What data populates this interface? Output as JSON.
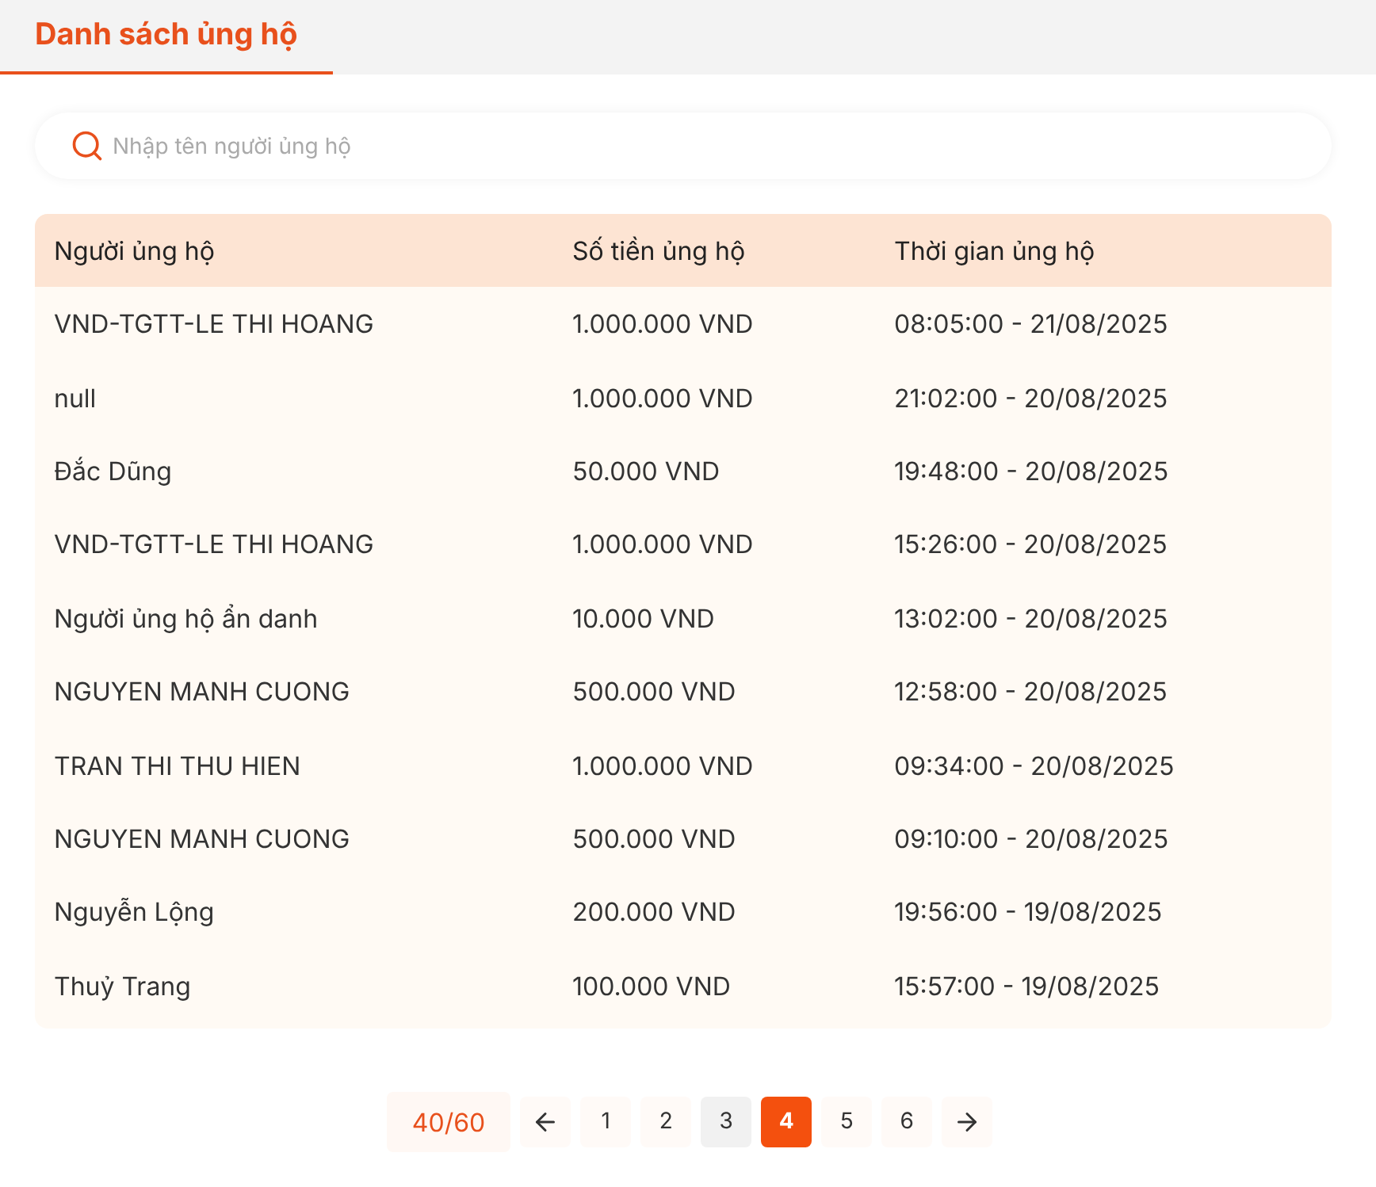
{
  "tabs": [
    {
      "label": "Danh sách ủng hộ",
      "selected": true
    }
  ],
  "search": {
    "placeholder": "Nhập tên người ủng hộ"
  },
  "table": {
    "columns": [
      "Người ủng hộ",
      "Số tiền ủng hộ",
      "Thời gian ủng hộ"
    ],
    "rows": [
      [
        "VND-TGTT-LE THI HOANG",
        "1.000.000 VND",
        "08:05:00 - 21/08/2025"
      ],
      [
        "null",
        "1.000.000 VND",
        "21:02:00 - 20/08/2025"
      ],
      [
        "Đắc Dũng",
        "50.000 VND",
        "19:48:00 - 20/08/2025"
      ],
      [
        "VND-TGTT-LE THI HOANG",
        "1.000.000 VND",
        "15:26:00 - 20/08/2025"
      ],
      [
        "Người ủng hộ ẩn danh",
        "10.000 VND",
        "13:02:00 - 20/08/2025"
      ],
      [
        "NGUYEN MANH CUONG",
        "500.000 VND",
        "12:58:00 - 20/08/2025"
      ],
      [
        "TRAN THI THU HIEN",
        "1.000.000 VND",
        "09:34:00 - 20/08/2025"
      ],
      [
        "NGUYEN MANH CUONG",
        "500.000 VND",
        "09:10:00 - 20/08/2025"
      ],
      [
        "Nguyễn Lộng",
        "200.000 VND",
        "19:56:00 - 19/08/2025"
      ],
      [
        "Thuỷ Trang",
        "100.000 VND",
        "15:57:00 - 19/08/2025"
      ]
    ]
  },
  "pagination": {
    "count": "40/60",
    "pages": [
      {
        "label": "1",
        "selected": false,
        "hovered": false
      },
      {
        "label": "2",
        "selected": false,
        "hovered": false
      },
      {
        "label": "3",
        "selected": false,
        "hovered": true
      },
      {
        "label": "4",
        "selected": true,
        "hovered": false
      },
      {
        "label": "5",
        "selected": false,
        "hovered": false
      },
      {
        "label": "6",
        "selected": false,
        "hovered": false
      }
    ]
  }
}
